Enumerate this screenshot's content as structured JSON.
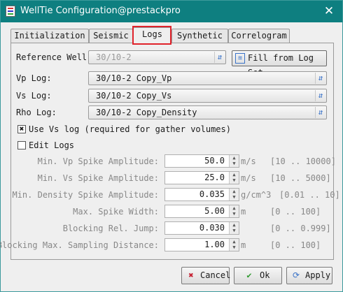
{
  "window": {
    "title": "WellTie Configuration@prestackpro",
    "close_glyph": "✕"
  },
  "tabs": [
    {
      "label": "Initialization"
    },
    {
      "label": "Seismic"
    },
    {
      "label": "Logs"
    },
    {
      "label": "Synthetic"
    },
    {
      "label": "Correlogram"
    }
  ],
  "active_tab": "Logs",
  "reference_well": {
    "label": "Reference Well:",
    "value": "30/10-2"
  },
  "fill_button": {
    "label": "Fill from Log Set"
  },
  "logs": [
    {
      "label": "Vp Log:",
      "value": "30/10-2 Copy_Vp"
    },
    {
      "label": "Vs Log:",
      "value": "30/10-2 Copy_Vs"
    },
    {
      "label": "Rho Log:",
      "value": "30/10-2 Copy_Density"
    }
  ],
  "use_vs": {
    "label": "Use Vs log (required for gather volumes)",
    "checked": true,
    "mark": "✖"
  },
  "edit_logs": {
    "label": "Edit Logs",
    "checked": false
  },
  "params": [
    {
      "label": "Min. Vp Spike Amplitude:",
      "value": "50.0",
      "unit": "m/s",
      "range": "[10 .. 10000]"
    },
    {
      "label": "Min. Vs Spike Amplitude:",
      "value": "25.0",
      "unit": "m/s",
      "range": "[10 .. 5000]"
    },
    {
      "label": "Min. Density Spike Amplitude:",
      "value": "0.035",
      "unit": "g/cm^3",
      "range": "[0.01 .. 10]"
    },
    {
      "label": "Max. Spike Width:",
      "value": "5.00",
      "unit": "m",
      "range": "[0 .. 100]"
    },
    {
      "label": "Blocking Rel. Jump:",
      "value": "0.030",
      "unit": "",
      "range": "[0 .. 0.999]"
    },
    {
      "label": "Blocking Max. Sampling Distance:",
      "value": "1.00",
      "unit": "m",
      "range": "[0 .. 100]"
    }
  ],
  "buttons": {
    "cancel": "Cancel",
    "ok": "Ok",
    "apply": "Apply"
  },
  "colors": {
    "titlebar": "#0e7f80",
    "highlight": "#e0232b",
    "accent": "#3a73c8"
  }
}
